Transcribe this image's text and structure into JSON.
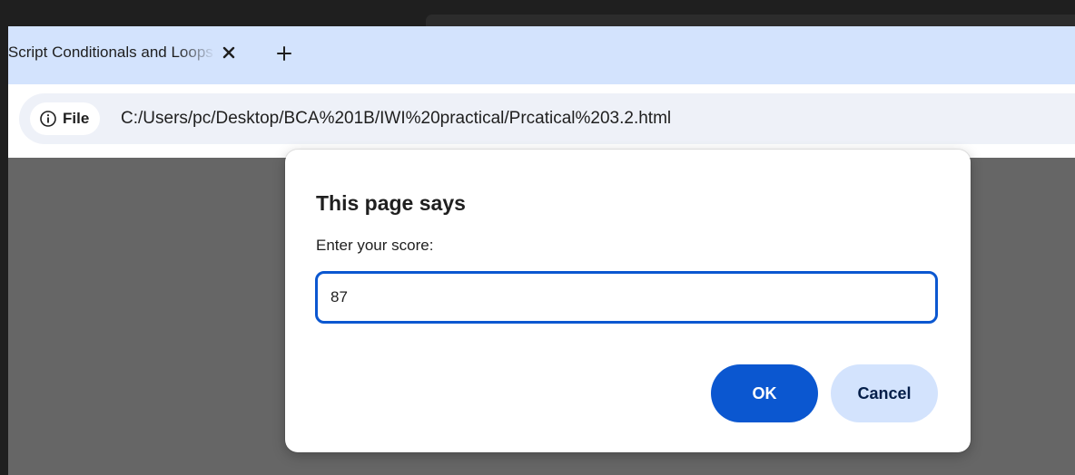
{
  "browser": {
    "tab": {
      "title": "JavaScript Conditionals and Loops",
      "close_icon": "close-icon"
    },
    "new_tab_icon": "plus-icon",
    "address_bar": {
      "site_info_icon": "info-icon",
      "site_info_label": "File",
      "url": "C:/Users/pc/Desktop/BCA%201B/IWI%20practical/Prcatical%203.2.html"
    }
  },
  "dialog": {
    "title": "This page says",
    "message": "Enter your score:",
    "input_value": "87",
    "ok_label": "OK",
    "cancel_label": "Cancel"
  },
  "colors": {
    "accent": "#0b57d0",
    "tab_strip": "#d3e3fd",
    "page_overlay": "#666666",
    "frame_dark": "#1f1f1f"
  }
}
